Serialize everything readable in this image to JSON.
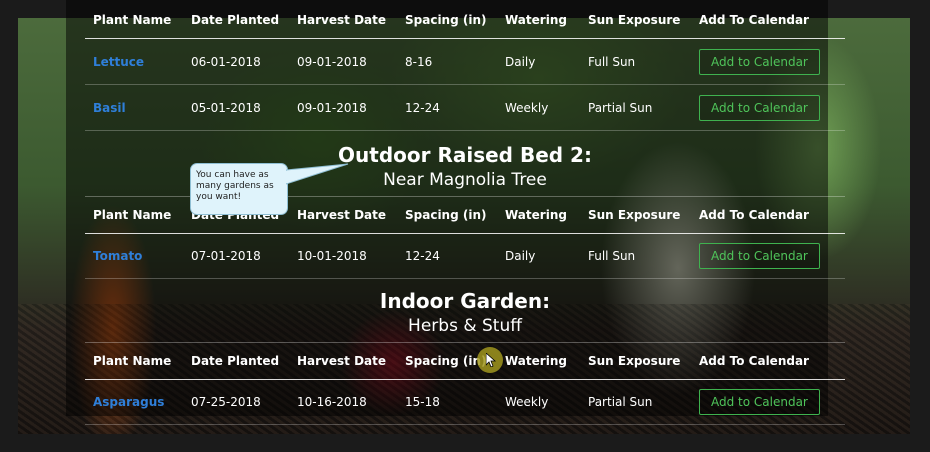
{
  "headers": {
    "plant_name": "Plant Name",
    "date_planted": "Date Planted",
    "harvest_date": "Harvest Date",
    "spacing": "Spacing (in)",
    "watering": "Watering",
    "sun_exposure": "Sun Exposure",
    "add_to_calendar": "Add To Calendar"
  },
  "gardens": [
    {
      "rows": [
        {
          "plant": "Lettuce",
          "planted": "06-01-2018",
          "harvest": "09-01-2018",
          "spacing": "8-16",
          "watering": "Daily",
          "sun": "Full Sun",
          "button": "Add to Calendar"
        },
        {
          "plant": "Basil",
          "planted": "05-01-2018",
          "harvest": "09-01-2018",
          "spacing": "12-24",
          "watering": "Weekly",
          "sun": "Partial Sun",
          "button": "Add to Calendar"
        }
      ]
    },
    {
      "title": "Outdoor Raised Bed 2:",
      "subtitle": "Near Magnolia Tree",
      "rows": [
        {
          "plant": "Tomato",
          "planted": "07-01-2018",
          "harvest": "10-01-2018",
          "spacing": "12-24",
          "watering": "Daily",
          "sun": "Full Sun",
          "button": "Add to Calendar"
        }
      ]
    },
    {
      "title": "Indoor Garden:",
      "subtitle": "Herbs & Stuff",
      "rows": [
        {
          "plant": "Asparagus",
          "planted": "07-25-2018",
          "harvest": "10-16-2018",
          "spacing": "15-18",
          "watering": "Weekly",
          "sun": "Partial Sun",
          "button": "Add to Calendar"
        }
      ]
    }
  ],
  "tooltip": {
    "text": "You can have as many gardens as you want!"
  },
  "colors": {
    "link": "#2f7fd9",
    "button": "#4fc45a",
    "cursor_halo": "#a0961e"
  }
}
